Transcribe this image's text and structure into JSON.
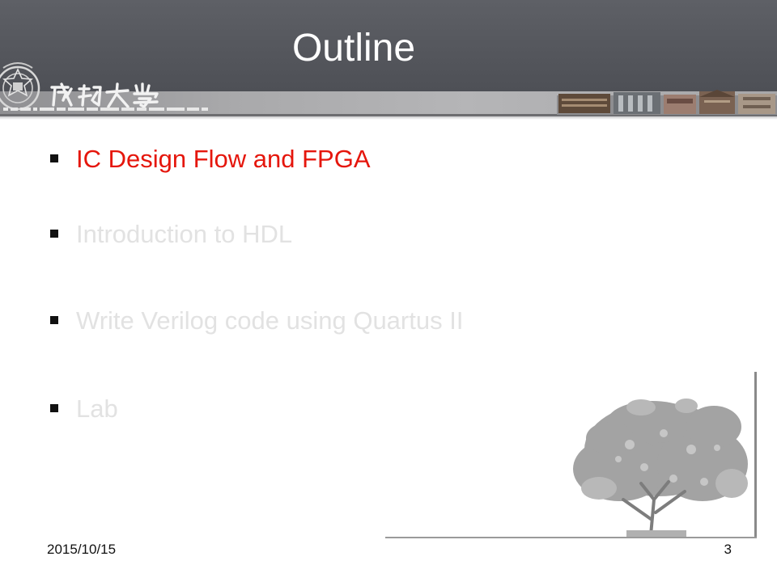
{
  "slide": {
    "title": "Outline",
    "items": [
      {
        "label": "IC Design Flow and FPGA",
        "state": "current",
        "color": "#e5160c"
      },
      {
        "label": "Introduction to HDL",
        "state": "upcoming",
        "color": "#e2e2e2"
      },
      {
        "label": "Write Verilog code using Quartus II",
        "state": "upcoming",
        "color": "#e2e2e2"
      },
      {
        "label": "Lab",
        "state": "upcoming",
        "color": "#e2e2e2"
      }
    ]
  },
  "header": {
    "band_color": "#55575d",
    "strip_color": "#a9a9ab",
    "logo_text": "成功大學",
    "seal_icon": "university-seal-icon",
    "campus_icon": "campus-buildings-strip"
  },
  "decoration": {
    "tree_icon": "tree-illustration"
  },
  "footer": {
    "date": "2015/10/15",
    "slide_number": "3"
  }
}
